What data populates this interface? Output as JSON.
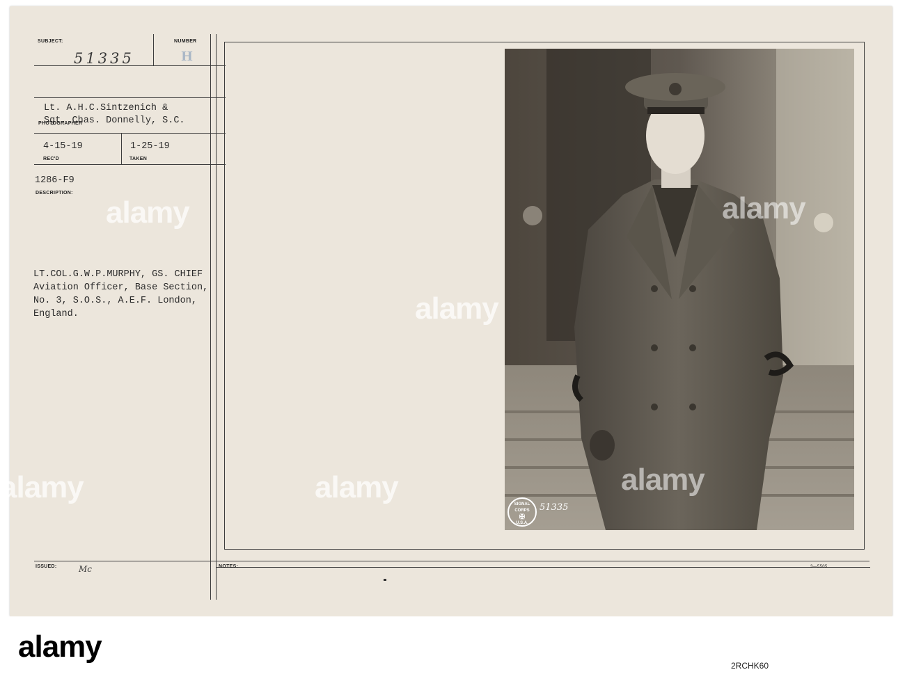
{
  "form": {
    "subject_label": "SUBJECT:",
    "number_label": "NUMBER",
    "subject_number": "51335",
    "number_mark": "H",
    "photographer": "Lt. A.H.C.Sintzenich &\nSgt. Chas. Donnelly, S.C.",
    "photographer_label": "PHOTOGRAPHER",
    "recd_date": "4-15-19",
    "recd_label": "REC'D",
    "taken_date": "1-25-19",
    "taken_label": "TAKEN",
    "file_code": "1286-F9",
    "description_label": "DESCRIPTION:",
    "description": "LT.COL.G.W.P.MURPHY, GS. CHIEF\nAviation Officer, Base Section,\nNo. 3, S.O.S., A.E.F. London,\nEngland.",
    "issued_label": "ISSUED:",
    "issued_initials": "Mc",
    "notes_label": "NOTES:",
    "form_code": "3—5505"
  },
  "photo": {
    "stamp_text": "SIGNAL CORPS",
    "stamp_country": "U.S.A.",
    "photo_number": "51335"
  },
  "watermark": {
    "text": "alamy",
    "image_id": "2RCHK60"
  }
}
